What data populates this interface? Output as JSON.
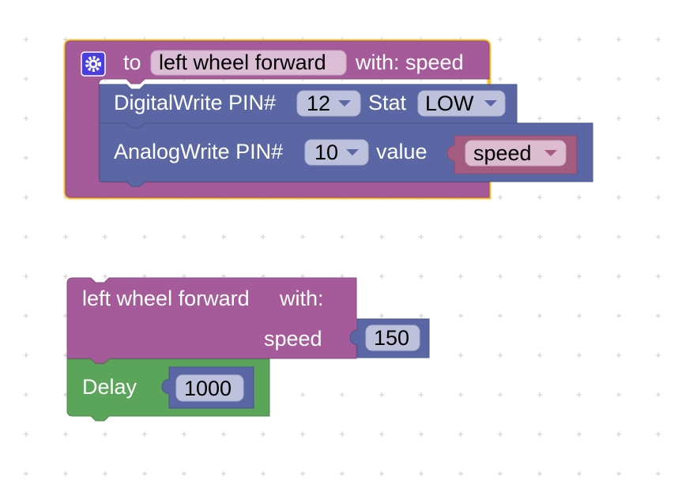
{
  "workspace": {
    "grid_color": "#cccccc",
    "background": "#ffffff"
  },
  "procedure_def": {
    "color": "#a55b99",
    "selection_color": "#fbc02d",
    "gear_icon": "gear-icon",
    "prefix": "to",
    "name": "left wheel forward",
    "params_label": "with: speed",
    "statements": [
      {
        "type": "DigitalWrite",
        "color": "#5b67a5",
        "label": "DigitalWrite PIN#",
        "pin": "12",
        "state_label": "Stat",
        "state": "LOW"
      },
      {
        "type": "AnalogWrite",
        "color": "#5b67a5",
        "label": "AnalogWrite PIN#",
        "pin": "10",
        "value_label": "value",
        "value_variable": "speed",
        "variable_color": "#a55b80"
      }
    ]
  },
  "procedure_call": {
    "color": "#a55b99",
    "label": "left wheel forward",
    "with_label": "with:",
    "arg_name": "speed",
    "arg_value": "150",
    "arg_color": "#5b67a5"
  },
  "delay_block": {
    "color": "#5ba55b",
    "label": "Delay",
    "value": "1000",
    "value_color": "#5b67a5"
  }
}
